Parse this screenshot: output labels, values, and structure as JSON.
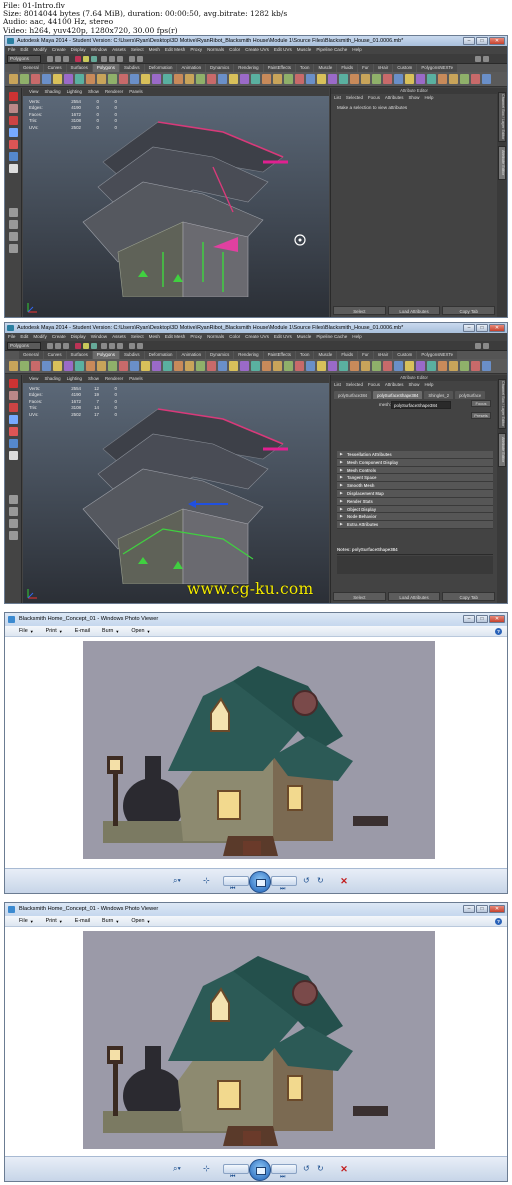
{
  "file_info": {
    "line1": "File: 01-Intro.flv",
    "line2": "Size: 8014044 bytes (7.64 MiB), duration: 00:00:50, avg.bitrate: 1282 kb/s",
    "line3": "Audio: aac, 44100 Hz, stereo",
    "line4": "Video: h264, yuv420p, 1280x720, 30.00 fps(r)"
  },
  "maya1": {
    "title": "Autodesk Maya 2014 - Student Version: C:\\Users\\Ryan\\Desktop\\3D Motive\\RyanRibot_Blacksmith House\\Module 1\\Source Files\\Blacksmith_House_01.0006.mb*",
    "menu": [
      "File",
      "Edit",
      "Modify",
      "Create",
      "Display",
      "Window",
      "Assets",
      "Select",
      "Mesh",
      "Edit Mesh",
      "Proxy",
      "Normals",
      "Color",
      "Create UVs",
      "Edit UVs",
      "Muscle",
      "Pipeline Cache",
      "Help"
    ],
    "mode": "Polygons",
    "shelf_tabs": [
      "General",
      "Curves",
      "Surfaces",
      "Polygons",
      "Subdivs",
      "Deformation",
      "Animation",
      "Dynamics",
      "Rendering",
      "PaintEffects",
      "Toon",
      "Muscle",
      "Fluids",
      "Fur",
      "nHair",
      "Custom",
      "PolygonsNEXTe"
    ],
    "active_shelf": "Polygons",
    "viewport_menu": [
      "View",
      "Shading",
      "Lighting",
      "Show",
      "Renderer",
      "Panels"
    ],
    "hud": [
      {
        "k": "Verts:",
        "a": "2554",
        "b": "0",
        "c": "0"
      },
      {
        "k": "Edges:",
        "a": "4190",
        "b": "0",
        "c": "0"
      },
      {
        "k": "Faces:",
        "a": "1672",
        "b": "0",
        "c": "0"
      },
      {
        "k": "Tris:",
        "a": "3108",
        "b": "0",
        "c": "0"
      },
      {
        "k": "UVs:",
        "a": "2502",
        "b": "0",
        "c": "0"
      }
    ],
    "attr_title": "Attribute Editor",
    "attr_menu": [
      "List",
      "Selected",
      "Focus",
      "Attributes",
      "Show",
      "Help"
    ],
    "attr_message": "Make a selection to view attributes",
    "attr_buttons": [
      "Select",
      "Load Attributes",
      "Copy Tab"
    ],
    "side_tabs": [
      "Channel Box / Layer Editor",
      "Attribute Editor"
    ]
  },
  "maya2": {
    "title": "Autodesk Maya 2014 - Student Version: C:\\Users\\Ryan\\Desktop\\3D Motive\\RyanRibot_Blacksmith House\\Module 1\\Source Files\\Blacksmith_House_01.0006.mb*",
    "menu": [
      "File",
      "Edit",
      "Modify",
      "Create",
      "Display",
      "Window",
      "Assets",
      "Select",
      "Mesh",
      "Edit Mesh",
      "Proxy",
      "Normals",
      "Color",
      "Create UVs",
      "Edit UVs",
      "Muscle",
      "Pipeline Cache",
      "Help"
    ],
    "mode": "Polygons",
    "shelf_tabs": [
      "General",
      "Curves",
      "Surfaces",
      "Polygons",
      "Subdivs",
      "Deformation",
      "Animation",
      "Dynamics",
      "Rendering",
      "PaintEffects",
      "Toon",
      "Muscle",
      "Fluids",
      "Fur",
      "nHair",
      "Custom",
      "PolygonsNEXTe"
    ],
    "active_shelf": "Polygons",
    "viewport_menu": [
      "View",
      "Shading",
      "Lighting",
      "Show",
      "Renderer",
      "Panels"
    ],
    "hud": [
      {
        "k": "Verts:",
        "a": "2554",
        "b": "12",
        "c": "0"
      },
      {
        "k": "Edges:",
        "a": "4190",
        "b": "19",
        "c": "0"
      },
      {
        "k": "Faces:",
        "a": "1672",
        "b": "7",
        "c": "0"
      },
      {
        "k": "Tris:",
        "a": "3108",
        "b": "14",
        "c": "0"
      },
      {
        "k": "UVs:",
        "a": "2502",
        "b": "17",
        "c": "0"
      }
    ],
    "attr_title": "Attribute Editor",
    "attr_menu": [
      "List",
      "Selected",
      "Focus",
      "Attributes",
      "Show",
      "Help"
    ],
    "attr_tabs": [
      "polySurface384",
      "polySurfaceShape384",
      "Shingles_2",
      "polySurface"
    ],
    "mesh_label": "mesh:",
    "mesh_value": "polySurfaceShape384",
    "focus_button": "Focus",
    "presets_button": "Presets",
    "sections": [
      "Tessellation Attributes",
      "Mesh Component Display",
      "Mesh Controls",
      "Tangent Space",
      "Smooth Mesh",
      "Displacement Map",
      "Render Stats",
      "Object Display",
      "Node Behavior",
      "Extra Attributes"
    ],
    "notes": "Notes:  polySurfaceShape384",
    "attr_buttons": [
      "Select",
      "Load Attributes",
      "Copy Tab"
    ],
    "side_tabs": [
      "Channel Box / Layer Editor",
      "Attribute Editor"
    ]
  },
  "watermark": "www.cg-ku.com",
  "viewer1": {
    "title": "Blacksmith Home_Concept_01 - Windows Photo Viewer",
    "menu": [
      "File",
      "Print",
      "E-mail",
      "Burn",
      "Open"
    ],
    "help": "?"
  },
  "viewer2": {
    "title": "Blacksmith Home_Concept_01 - Windows Photo Viewer",
    "menu": [
      "File",
      "Print",
      "E-mail",
      "Burn",
      "Open"
    ],
    "help": "?"
  },
  "colors": {
    "maya_bg": "#444444",
    "viewport_top": "#5d6a7a",
    "photo_bg": "#9b9aa8",
    "roof_teal": "#2c5a56",
    "watermark": "#f5ec00"
  }
}
